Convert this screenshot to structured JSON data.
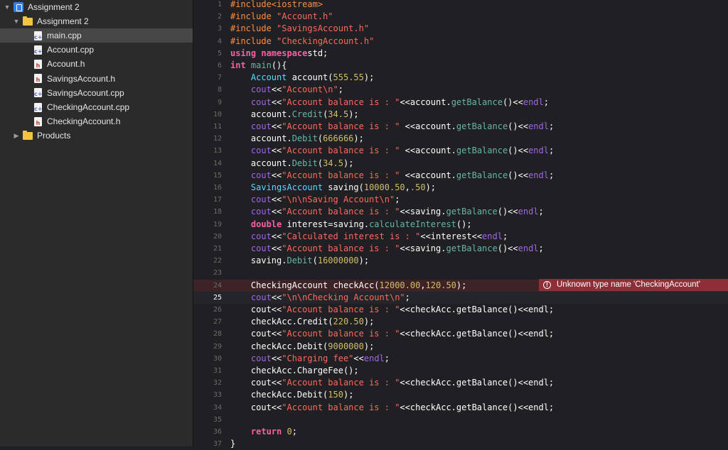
{
  "navigator": {
    "project": "Assignment 2",
    "group": "Assignment 2",
    "files": [
      {
        "name": "main.cpp",
        "kind": "cpp",
        "selected": true
      },
      {
        "name": "Account.cpp",
        "kind": "cpp"
      },
      {
        "name": "Account.h",
        "kind": "h"
      },
      {
        "name": "SavingsAccount.h",
        "kind": "h"
      },
      {
        "name": "SavingsAccount.cpp",
        "kind": "cpp"
      },
      {
        "name": "CheckingAccount.cpp",
        "kind": "cpp"
      },
      {
        "name": "CheckingAccount.h",
        "kind": "h"
      }
    ],
    "products": "Products",
    "file_badge_cpp": "c+",
    "file_badge_h": "h"
  },
  "editor": {
    "current_line": 25,
    "error_line": 24,
    "error_message": "Unknown type name 'CheckingAccount'",
    "lines": [
      [
        [
          "pp",
          "#include<iostream>"
        ]
      ],
      [
        [
          "pp",
          "#include "
        ],
        [
          "str",
          "\"Account.h\""
        ]
      ],
      [
        [
          "pp",
          "#include "
        ],
        [
          "str",
          "\"SavingsAccount.h\""
        ]
      ],
      [
        [
          "pp",
          "#include "
        ],
        [
          "str",
          "\"CheckingAccount.h\""
        ]
      ],
      [
        [
          "kw",
          "using namespace"
        ],
        [
          "",
          "std;"
        ]
      ],
      [
        [
          "kw",
          "int "
        ],
        [
          "fn",
          "main"
        ],
        [
          "",
          "(){"
        ]
      ],
      [
        [
          "",
          "    "
        ],
        [
          "typ",
          "Account"
        ],
        [
          "",
          " account("
        ],
        [
          "num",
          "555.55"
        ],
        [
          "",
          ");"
        ]
      ],
      [
        [
          "",
          "    "
        ],
        [
          "mth",
          "cout"
        ],
        [
          "",
          "<<"
        ],
        [
          "str",
          "\"Account\\n\""
        ],
        [
          "",
          ";"
        ]
      ],
      [
        [
          "",
          "    "
        ],
        [
          "mth",
          "cout"
        ],
        [
          "",
          "<<"
        ],
        [
          "str",
          "\"Account balance is : \""
        ],
        [
          "",
          "<<account."
        ],
        [
          "fn",
          "getBalance"
        ],
        [
          "",
          "()<<"
        ],
        [
          "mth",
          "endl"
        ],
        [
          "",
          ";"
        ]
      ],
      [
        [
          "",
          "    account."
        ],
        [
          "fn",
          "Credit"
        ],
        [
          "",
          "("
        ],
        [
          "num",
          "34.5"
        ],
        [
          "",
          ");"
        ]
      ],
      [
        [
          "",
          "    "
        ],
        [
          "mth",
          "cout"
        ],
        [
          "",
          "<<"
        ],
        [
          "str",
          "\"Account balance is : \""
        ],
        [
          "",
          " <<account."
        ],
        [
          "fn",
          "getBalance"
        ],
        [
          "",
          "()<<"
        ],
        [
          "mth",
          "endl"
        ],
        [
          "",
          ";"
        ]
      ],
      [
        [
          "",
          "    account."
        ],
        [
          "fn",
          "Debit"
        ],
        [
          "",
          "("
        ],
        [
          "num",
          "666666"
        ],
        [
          "",
          ");"
        ]
      ],
      [
        [
          "",
          "    "
        ],
        [
          "mth",
          "cout"
        ],
        [
          "",
          "<<"
        ],
        [
          "str",
          "\"Account balance is : \""
        ],
        [
          "",
          " <<account."
        ],
        [
          "fn",
          "getBalance"
        ],
        [
          "",
          "()<<"
        ],
        [
          "mth",
          "endl"
        ],
        [
          "",
          ";"
        ]
      ],
      [
        [
          "",
          "    account."
        ],
        [
          "fn",
          "Debit"
        ],
        [
          "",
          "("
        ],
        [
          "num",
          "34.5"
        ],
        [
          "",
          ");"
        ]
      ],
      [
        [
          "",
          "    "
        ],
        [
          "mth",
          "cout"
        ],
        [
          "",
          "<<"
        ],
        [
          "str",
          "\"Account balance is : \""
        ],
        [
          "",
          " <<account."
        ],
        [
          "fn",
          "getBalance"
        ],
        [
          "",
          "()<<"
        ],
        [
          "mth",
          "endl"
        ],
        [
          "",
          ";"
        ]
      ],
      [
        [
          "",
          "    "
        ],
        [
          "typ",
          "SavingsAccount"
        ],
        [
          "",
          " saving("
        ],
        [
          "num",
          "10000.50"
        ],
        [
          "",
          ","
        ],
        [
          "num",
          ".50"
        ],
        [
          "",
          ");"
        ]
      ],
      [
        [
          "",
          "    "
        ],
        [
          "mth",
          "cout"
        ],
        [
          "",
          "<<"
        ],
        [
          "str",
          "\"\\n\\nSaving Account\\n\""
        ],
        [
          "",
          ";"
        ]
      ],
      [
        [
          "",
          "    "
        ],
        [
          "mth",
          "cout"
        ],
        [
          "",
          "<<"
        ],
        [
          "str",
          "\"Account balance is : \""
        ],
        [
          "",
          "<<saving."
        ],
        [
          "fn",
          "getBalance"
        ],
        [
          "",
          "()<<"
        ],
        [
          "mth",
          "endl"
        ],
        [
          "",
          ";"
        ]
      ],
      [
        [
          "",
          "    "
        ],
        [
          "kw",
          "double "
        ],
        [
          "",
          "interest=saving."
        ],
        [
          "fn",
          "calculateInterest"
        ],
        [
          "",
          "();"
        ]
      ],
      [
        [
          "",
          "    "
        ],
        [
          "mth",
          "cout"
        ],
        [
          "",
          "<<"
        ],
        [
          "str",
          "\"Calculated interest is : \""
        ],
        [
          "",
          "<<interest<<"
        ],
        [
          "mth",
          "endl"
        ],
        [
          "",
          ";"
        ]
      ],
      [
        [
          "",
          "    "
        ],
        [
          "mth",
          "cout"
        ],
        [
          "",
          "<<"
        ],
        [
          "str",
          "\"Account balance is : \""
        ],
        [
          "",
          "<<saving."
        ],
        [
          "fn",
          "getBalance"
        ],
        [
          "",
          "()<<"
        ],
        [
          "mth",
          "endl"
        ],
        [
          "",
          ";"
        ]
      ],
      [
        [
          "",
          "    saving."
        ],
        [
          "fn",
          "Debit"
        ],
        [
          "",
          "("
        ],
        [
          "num",
          "16000000"
        ],
        [
          "",
          ");"
        ]
      ],
      [],
      [
        [
          "",
          "    CheckingAccount checkAcc("
        ],
        [
          "num",
          "12000.00"
        ],
        [
          "",
          ","
        ],
        [
          "num",
          "120.50"
        ],
        [
          "",
          ");"
        ]
      ],
      [
        [
          "",
          "    "
        ],
        [
          "mth",
          "cout"
        ],
        [
          "",
          "<<"
        ],
        [
          "str",
          "\"\\n\\nChecking Account\\n\""
        ],
        [
          "",
          ";"
        ]
      ],
      [
        [
          "",
          "    cout<<"
        ],
        [
          "str",
          "\"Account balance is : \""
        ],
        [
          "",
          "<<checkAcc.getBalance()<<endl;"
        ]
      ],
      [
        [
          "",
          "    checkAcc.Credit("
        ],
        [
          "num",
          "220.50"
        ],
        [
          "",
          ");"
        ]
      ],
      [
        [
          "",
          "    cout<<"
        ],
        [
          "str",
          "\"Account balance is : \""
        ],
        [
          "",
          "<<checkAcc.getBalance()<<endl;"
        ]
      ],
      [
        [
          "",
          "    checkAcc.Debit("
        ],
        [
          "num",
          "9000000"
        ],
        [
          "",
          ");"
        ]
      ],
      [
        [
          "",
          "    "
        ],
        [
          "mth",
          "cout"
        ],
        [
          "",
          "<<"
        ],
        [
          "str",
          "\"Charging fee\""
        ],
        [
          "",
          "<<"
        ],
        [
          "mth",
          "endl"
        ],
        [
          "",
          ";"
        ]
      ],
      [
        [
          "",
          "    checkAcc.ChargeFee();"
        ]
      ],
      [
        [
          "",
          "    cout<<"
        ],
        [
          "str",
          "\"Account balance is : \""
        ],
        [
          "",
          "<<checkAcc.getBalance()<<endl;"
        ]
      ],
      [
        [
          "",
          "    checkAcc.Debit("
        ],
        [
          "num",
          "150"
        ],
        [
          "",
          ");"
        ]
      ],
      [
        [
          "",
          "    cout<<"
        ],
        [
          "str",
          "\"Account balance is : \""
        ],
        [
          "",
          "<<checkAcc.getBalance()<<endl;"
        ]
      ],
      [],
      [
        [
          "",
          "    "
        ],
        [
          "kw",
          "return "
        ],
        [
          "num",
          "0"
        ],
        [
          "",
          ";"
        ]
      ],
      [
        [
          "",
          "}"
        ]
      ]
    ]
  }
}
